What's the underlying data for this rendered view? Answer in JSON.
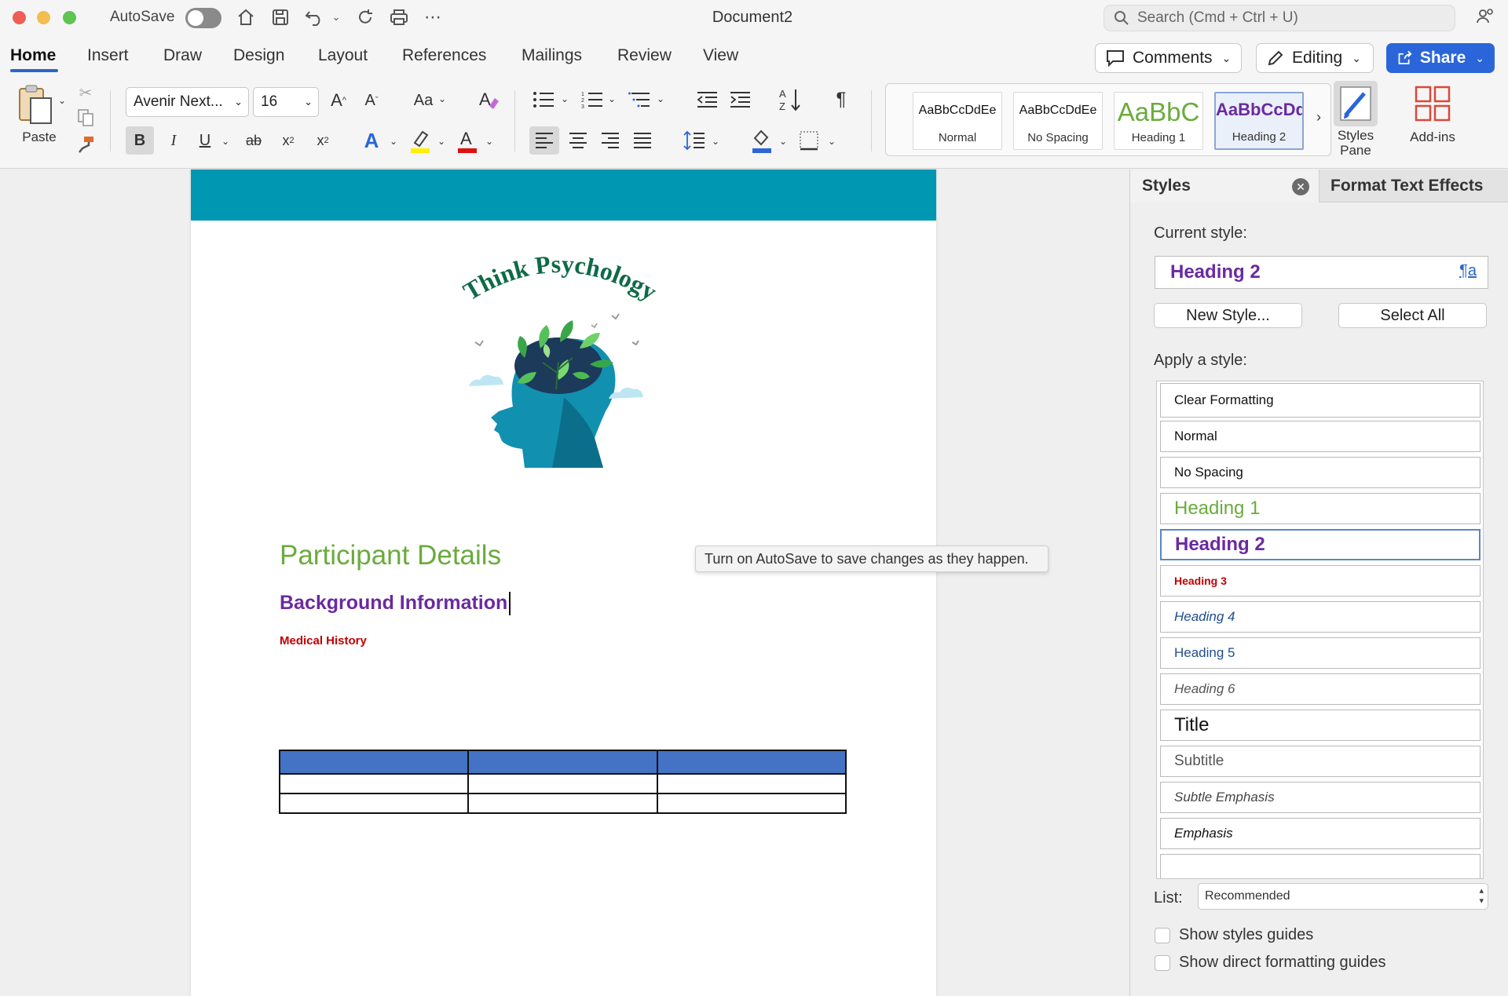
{
  "window": {
    "title": "Document2",
    "autosave_label": "AutoSave",
    "autosave_on": false,
    "search_placeholder": "Search (Cmd + Ctrl + U)"
  },
  "tabs": [
    {
      "label": "Home",
      "active": true
    },
    {
      "label": "Insert"
    },
    {
      "label": "Draw"
    },
    {
      "label": "Design"
    },
    {
      "label": "Layout"
    },
    {
      "label": "References"
    },
    {
      "label": "Mailings"
    },
    {
      "label": "Review"
    },
    {
      "label": "View"
    }
  ],
  "header_buttons": {
    "comments": "Comments",
    "editing": "Editing",
    "share": "Share"
  },
  "ribbon": {
    "paste_label": "Paste",
    "font_name": "Avenir Next...",
    "font_size": "16",
    "change_case": "Aa",
    "styles_pane_label": "Styles Pane",
    "addins_label": "Add-ins",
    "gallery": [
      {
        "preview": "AaBbCcDdEe",
        "name": "Normal"
      },
      {
        "preview": "AaBbCcDdEe",
        "name": "No Spacing"
      },
      {
        "preview": "AaBbC",
        "name": "Heading 1"
      },
      {
        "preview": "AaBbCcDd",
        "name": "Heading 2",
        "selected": true
      }
    ]
  },
  "document": {
    "logo_text": "Think Psychology",
    "heading1": "Participant Details",
    "heading2": "Background Information",
    "heading3": "Medical History",
    "table": {
      "rows": 3,
      "cols": 3,
      "header_color": "#4472c4"
    },
    "header_band_color": "#0097b3"
  },
  "tooltip": "Turn on AutoSave to save changes as they happen.",
  "styles_pane": {
    "tab_styles": "Styles",
    "tab_effects": "Format Text Effects",
    "current_style_label": "Current style:",
    "current_style": "Heading 2",
    "new_style": "New Style...",
    "select_all": "Select All",
    "apply_label": "Apply a style:",
    "styles": [
      "Clear Formatting",
      "Normal",
      "No Spacing",
      "Heading 1",
      "Heading 2",
      "Heading 3",
      "Heading 4",
      "Heading 5",
      "Heading 6",
      "Title",
      "Subtitle",
      "Subtle Emphasis",
      "Emphasis"
    ],
    "selected_style": "Heading 2",
    "list_label": "List:",
    "list_value": "Recommended",
    "show_styles_guides": "Show styles guides",
    "show_direct_formatting_guides": "Show direct formatting guides"
  },
  "colors": {
    "accent": "#2a66d9",
    "heading1": "#6aab3d",
    "heading2": "#6a2aa0",
    "heading3": "#c00000"
  }
}
